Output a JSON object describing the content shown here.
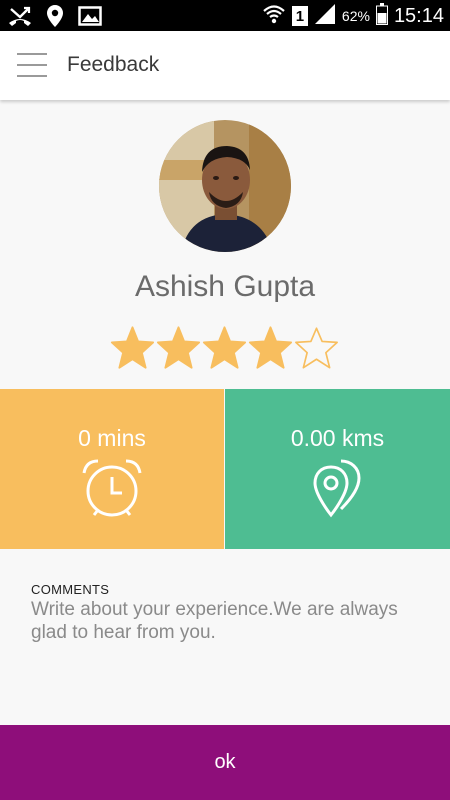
{
  "status_bar": {
    "battery_percent": "62%",
    "sim_slot": "1",
    "time": "15:14",
    "icons": [
      "missed-call-icon",
      "location-icon",
      "image-icon",
      "wifi-icon",
      "signal-icon",
      "battery-icon"
    ]
  },
  "app_bar": {
    "title": "Feedback",
    "menu_icon": "menu-icon"
  },
  "driver": {
    "name": "Ashish Gupta",
    "rating": 4,
    "rating_max": 5
  },
  "stats": {
    "time": {
      "value": "0 mins",
      "icon": "alarm-clock-icon"
    },
    "distance": {
      "value": "0.00 kms",
      "icon": "map-pins-icon"
    }
  },
  "comments": {
    "label": "COMMENTS",
    "placeholder": "Write about your experience.We are always glad to hear from you.",
    "value": ""
  },
  "ok_button": {
    "label": "ok"
  },
  "colors": {
    "status_bar": "#000000",
    "star": "#f8be5e",
    "time_tile": "#f8be5e",
    "distance_tile": "#4ebd92",
    "ok_button": "#8e0e7a"
  }
}
